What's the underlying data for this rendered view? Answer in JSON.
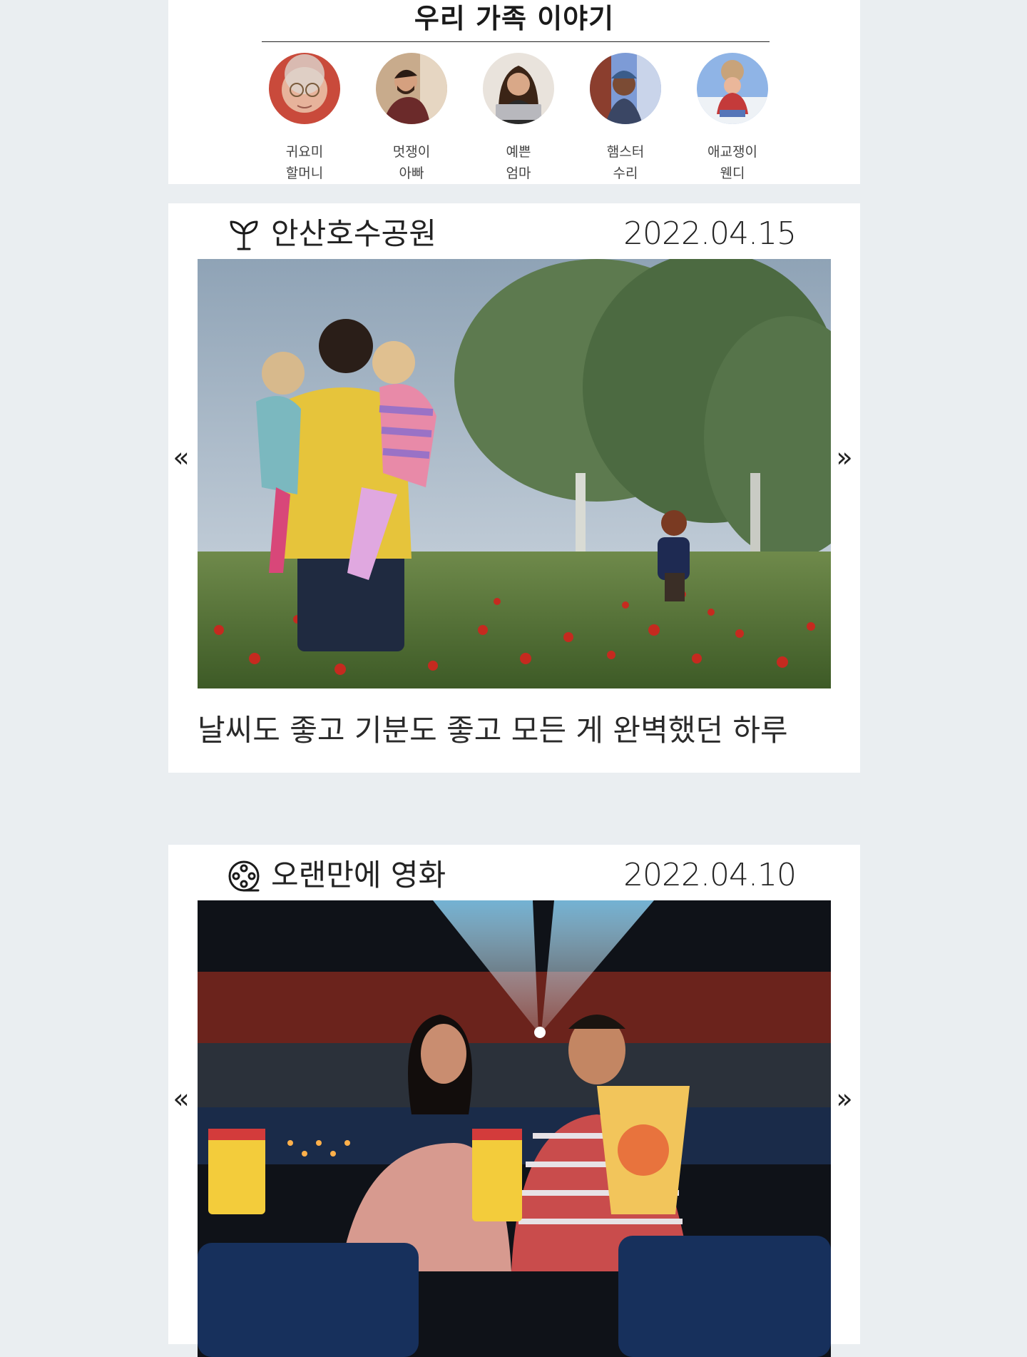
{
  "family": {
    "title": "우리 가족 이야기",
    "members": [
      {
        "line1": "귀요미",
        "line2": "할머니",
        "avatar": "grandma-photo"
      },
      {
        "line1": "멋쟁이",
        "line2": "아빠",
        "avatar": "dad-photo"
      },
      {
        "line1": "예쁜",
        "line2": "엄마",
        "avatar": "mom-photo"
      },
      {
        "line1": "햄스터",
        "line2": "수리",
        "avatar": "child-photo"
      },
      {
        "line1": "애교쟁이",
        "line2": "웬디",
        "avatar": "baby-photo"
      }
    ]
  },
  "posts": [
    {
      "icon": "sprout-icon",
      "title": "안산호수공원",
      "date": "2022.04.15",
      "photo": "family-in-poppy-field",
      "caption": "날씨도 좋고 기분도 좋고 모든 게 완벽했던 하루",
      "prev": "«",
      "next": "»"
    },
    {
      "icon": "film-reel-icon",
      "title": "오랜만에 영화",
      "date": "2022.04.10",
      "photo": "couple-in-cinema",
      "prev": "«",
      "next": "»"
    }
  ],
  "colors": {
    "page_background": "#eaeef1",
    "card_background": "#ffffff",
    "text": "#222222"
  }
}
